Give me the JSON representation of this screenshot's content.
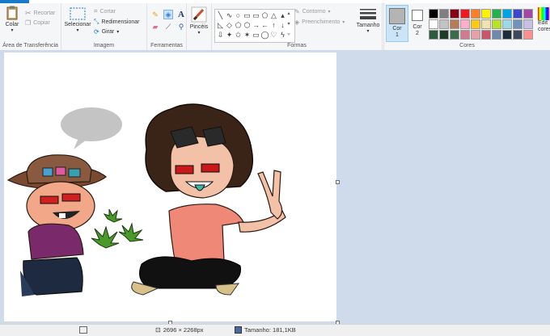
{
  "ribbon": {
    "clipboard": {
      "paste": "Colar",
      "cut": "Recortar",
      "copy": "Copiar",
      "label": "Área de Transferência"
    },
    "image": {
      "select": "Selecionar",
      "crop": "Cortar",
      "resize": "Redimensionar",
      "rotate": "Girar",
      "label": "Imagem"
    },
    "tools": {
      "label": "Ferramentas",
      "text_icon": "A"
    },
    "brushes": {
      "label": "Pincéis"
    },
    "shapes": {
      "outline": "Contorno",
      "fill": "Preenchimento",
      "label": "Formas",
      "glyphs": [
        "╲",
        "∿",
        "○",
        "▭",
        "▭",
        "⬠",
        "△",
        "▴",
        "◺",
        "◇",
        "⬠",
        "⬡",
        "→",
        "←",
        "↑",
        "↓",
        "⇩",
        "✦",
        "✩",
        "✶",
        "▭",
        "◯",
        "♡",
        "ϟ"
      ]
    },
    "size": {
      "label": "Tamanho"
    },
    "colors": {
      "color1": "Cor 1",
      "color2": "Cor 2",
      "label": "Cores",
      "edit": "Edit cores",
      "color1_value": "#b4b4b4",
      "color2_value": "#ffffff",
      "palette": [
        "#000000",
        "#7f7f7f",
        "#880015",
        "#ed1c24",
        "#ff7f27",
        "#fff200",
        "#22b14c",
        "#00a2e8",
        "#3f48cc",
        "#a349a4",
        "#ffffff",
        "#c3c3c3",
        "#b97a57",
        "#ffaec9",
        "#ffc90e",
        "#efe4b0",
        "#b5e61d",
        "#99d9ea",
        "#7092be",
        "#c8bfe7",
        "#2d5a3c",
        "#1f3b26",
        "#3a6b4a",
        "#d17b8e",
        "#e8a0a8",
        "#c9566a",
        "#6e88b0",
        "#1e2d3e",
        "#3e4a5c",
        "#ff8f8f"
      ]
    }
  },
  "status": {
    "dimensions": "2696 × 2268px",
    "size": "Tamanho: 181,1KB"
  }
}
